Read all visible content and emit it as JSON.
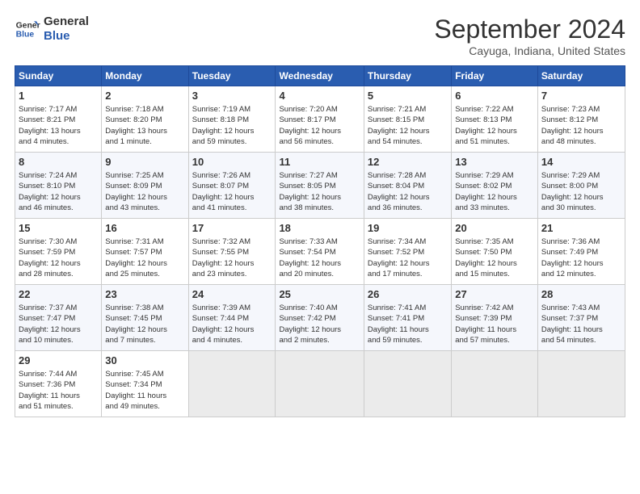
{
  "header": {
    "logo_line1": "General",
    "logo_line2": "Blue",
    "month_title": "September 2024",
    "location": "Cayuga, Indiana, United States"
  },
  "days_of_week": [
    "Sunday",
    "Monday",
    "Tuesday",
    "Wednesday",
    "Thursday",
    "Friday",
    "Saturday"
  ],
  "weeks": [
    [
      {
        "day": "1",
        "lines": [
          "Sunrise: 7:17 AM",
          "Sunset: 8:21 PM",
          "Daylight: 13 hours",
          "and 4 minutes."
        ]
      },
      {
        "day": "2",
        "lines": [
          "Sunrise: 7:18 AM",
          "Sunset: 8:20 PM",
          "Daylight: 13 hours",
          "and 1 minute."
        ]
      },
      {
        "day": "3",
        "lines": [
          "Sunrise: 7:19 AM",
          "Sunset: 8:18 PM",
          "Daylight: 12 hours",
          "and 59 minutes."
        ]
      },
      {
        "day": "4",
        "lines": [
          "Sunrise: 7:20 AM",
          "Sunset: 8:17 PM",
          "Daylight: 12 hours",
          "and 56 minutes."
        ]
      },
      {
        "day": "5",
        "lines": [
          "Sunrise: 7:21 AM",
          "Sunset: 8:15 PM",
          "Daylight: 12 hours",
          "and 54 minutes."
        ]
      },
      {
        "day": "6",
        "lines": [
          "Sunrise: 7:22 AM",
          "Sunset: 8:13 PM",
          "Daylight: 12 hours",
          "and 51 minutes."
        ]
      },
      {
        "day": "7",
        "lines": [
          "Sunrise: 7:23 AM",
          "Sunset: 8:12 PM",
          "Daylight: 12 hours",
          "and 48 minutes."
        ]
      }
    ],
    [
      {
        "day": "8",
        "lines": [
          "Sunrise: 7:24 AM",
          "Sunset: 8:10 PM",
          "Daylight: 12 hours",
          "and 46 minutes."
        ]
      },
      {
        "day": "9",
        "lines": [
          "Sunrise: 7:25 AM",
          "Sunset: 8:09 PM",
          "Daylight: 12 hours",
          "and 43 minutes."
        ]
      },
      {
        "day": "10",
        "lines": [
          "Sunrise: 7:26 AM",
          "Sunset: 8:07 PM",
          "Daylight: 12 hours",
          "and 41 minutes."
        ]
      },
      {
        "day": "11",
        "lines": [
          "Sunrise: 7:27 AM",
          "Sunset: 8:05 PM",
          "Daylight: 12 hours",
          "and 38 minutes."
        ]
      },
      {
        "day": "12",
        "lines": [
          "Sunrise: 7:28 AM",
          "Sunset: 8:04 PM",
          "Daylight: 12 hours",
          "and 36 minutes."
        ]
      },
      {
        "day": "13",
        "lines": [
          "Sunrise: 7:29 AM",
          "Sunset: 8:02 PM",
          "Daylight: 12 hours",
          "and 33 minutes."
        ]
      },
      {
        "day": "14",
        "lines": [
          "Sunrise: 7:29 AM",
          "Sunset: 8:00 PM",
          "Daylight: 12 hours",
          "and 30 minutes."
        ]
      }
    ],
    [
      {
        "day": "15",
        "lines": [
          "Sunrise: 7:30 AM",
          "Sunset: 7:59 PM",
          "Daylight: 12 hours",
          "and 28 minutes."
        ]
      },
      {
        "day": "16",
        "lines": [
          "Sunrise: 7:31 AM",
          "Sunset: 7:57 PM",
          "Daylight: 12 hours",
          "and 25 minutes."
        ]
      },
      {
        "day": "17",
        "lines": [
          "Sunrise: 7:32 AM",
          "Sunset: 7:55 PM",
          "Daylight: 12 hours",
          "and 23 minutes."
        ]
      },
      {
        "day": "18",
        "lines": [
          "Sunrise: 7:33 AM",
          "Sunset: 7:54 PM",
          "Daylight: 12 hours",
          "and 20 minutes."
        ]
      },
      {
        "day": "19",
        "lines": [
          "Sunrise: 7:34 AM",
          "Sunset: 7:52 PM",
          "Daylight: 12 hours",
          "and 17 minutes."
        ]
      },
      {
        "day": "20",
        "lines": [
          "Sunrise: 7:35 AM",
          "Sunset: 7:50 PM",
          "Daylight: 12 hours",
          "and 15 minutes."
        ]
      },
      {
        "day": "21",
        "lines": [
          "Sunrise: 7:36 AM",
          "Sunset: 7:49 PM",
          "Daylight: 12 hours",
          "and 12 minutes."
        ]
      }
    ],
    [
      {
        "day": "22",
        "lines": [
          "Sunrise: 7:37 AM",
          "Sunset: 7:47 PM",
          "Daylight: 12 hours",
          "and 10 minutes."
        ]
      },
      {
        "day": "23",
        "lines": [
          "Sunrise: 7:38 AM",
          "Sunset: 7:45 PM",
          "Daylight: 12 hours",
          "and 7 minutes."
        ]
      },
      {
        "day": "24",
        "lines": [
          "Sunrise: 7:39 AM",
          "Sunset: 7:44 PM",
          "Daylight: 12 hours",
          "and 4 minutes."
        ]
      },
      {
        "day": "25",
        "lines": [
          "Sunrise: 7:40 AM",
          "Sunset: 7:42 PM",
          "Daylight: 12 hours",
          "and 2 minutes."
        ]
      },
      {
        "day": "26",
        "lines": [
          "Sunrise: 7:41 AM",
          "Sunset: 7:41 PM",
          "Daylight: 11 hours",
          "and 59 minutes."
        ]
      },
      {
        "day": "27",
        "lines": [
          "Sunrise: 7:42 AM",
          "Sunset: 7:39 PM",
          "Daylight: 11 hours",
          "and 57 minutes."
        ]
      },
      {
        "day": "28",
        "lines": [
          "Sunrise: 7:43 AM",
          "Sunset: 7:37 PM",
          "Daylight: 11 hours",
          "and 54 minutes."
        ]
      }
    ],
    [
      {
        "day": "29",
        "lines": [
          "Sunrise: 7:44 AM",
          "Sunset: 7:36 PM",
          "Daylight: 11 hours",
          "and 51 minutes."
        ]
      },
      {
        "day": "30",
        "lines": [
          "Sunrise: 7:45 AM",
          "Sunset: 7:34 PM",
          "Daylight: 11 hours",
          "and 49 minutes."
        ]
      },
      {
        "day": "",
        "lines": []
      },
      {
        "day": "",
        "lines": []
      },
      {
        "day": "",
        "lines": []
      },
      {
        "day": "",
        "lines": []
      },
      {
        "day": "",
        "lines": []
      }
    ]
  ]
}
